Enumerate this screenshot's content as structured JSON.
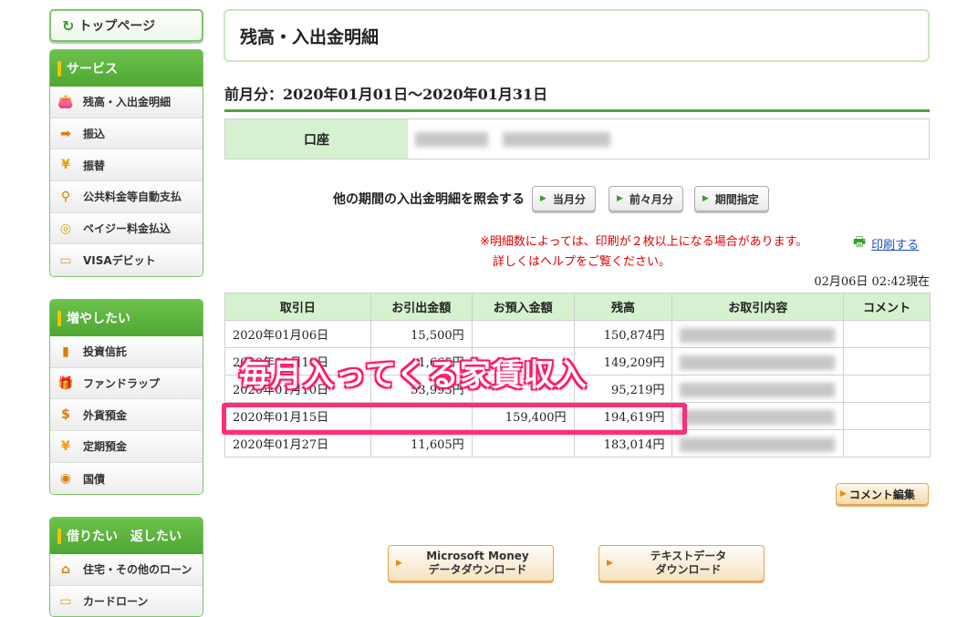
{
  "sidebar": {
    "top_button": "トップページ",
    "sections": [
      {
        "title": "サービス",
        "items": [
          {
            "label": "残高・入出金明細",
            "icon": "purse-icon"
          },
          {
            "label": "振込",
            "icon": "transfer-icon"
          },
          {
            "label": "振替",
            "icon": "yen-exchange-icon"
          },
          {
            "label": "公共料金等自動支払",
            "icon": "faucet-icon"
          },
          {
            "label": "ペイジー料金払込",
            "icon": "coins-icon"
          },
          {
            "label": "VISAデビット",
            "icon": "debit-card-icon"
          }
        ]
      },
      {
        "title": "増やしたい",
        "items": [
          {
            "label": "投資信託",
            "icon": "bar-chart-icon"
          },
          {
            "label": "ファンドラップ",
            "icon": "gift-icon"
          },
          {
            "label": "外貨預金",
            "icon": "dollar-icon"
          },
          {
            "label": "定期預金",
            "icon": "money-bag-icon"
          },
          {
            "label": "国債",
            "icon": "bond-icon"
          }
        ]
      },
      {
        "title": "借りたい　返したい",
        "items": [
          {
            "label": "住宅・その他のローン",
            "icon": "house-icon"
          },
          {
            "label": "カードローン",
            "icon": "card-icon"
          }
        ]
      }
    ]
  },
  "main": {
    "title": "残高・入出金明細",
    "period": "前月分：2020年01月01日〜2020年01月31日",
    "account_label": "口座",
    "inquiry_text": "他の期間の入出金明細を照会する",
    "period_buttons": [
      "当月分",
      "前々月分",
      "期間指定"
    ],
    "note_line1": "※明細数によっては、印刷が２枚以上になる場合があります。",
    "note_line2": "詳しくはヘルプをご覧ください。",
    "print_link": "印刷する",
    "timestamp": "02月06日 02:42現在",
    "table": {
      "headers": [
        "取引日",
        "お引出金額",
        "お預入金額",
        "残高",
        "お取引内容",
        "コメント"
      ],
      "rows": [
        [
          "2020年01月06日",
          "15,500円",
          "",
          "150,874円",
          "",
          ""
        ],
        [
          "2020年01月10日",
          "1,665円",
          "",
          "149,209円",
          "",
          ""
        ],
        [
          "2020年01月10日",
          "53,993円",
          "",
          "95,219円",
          "",
          ""
        ],
        [
          "2020年01月15日",
          "",
          "159,400円",
          "194,619円",
          "",
          ""
        ],
        [
          "2020年01月27日",
          "11,605円",
          "",
          "183,014円",
          "",
          ""
        ]
      ]
    },
    "overlay_caption": "毎月入ってくる家賃収入",
    "comment_edit_button": "コメント編集",
    "download_buttons": [
      {
        "line1": "Microsoft Money",
        "line2": "データダウンロード"
      },
      {
        "line1": "テキストデータ",
        "line2": "ダウンロード"
      }
    ]
  },
  "colors": {
    "brand_green": "#4ea634",
    "header_green": "#d6f1cf",
    "highlight_pink": "#ff2d7a",
    "note_red": "#e00000"
  }
}
